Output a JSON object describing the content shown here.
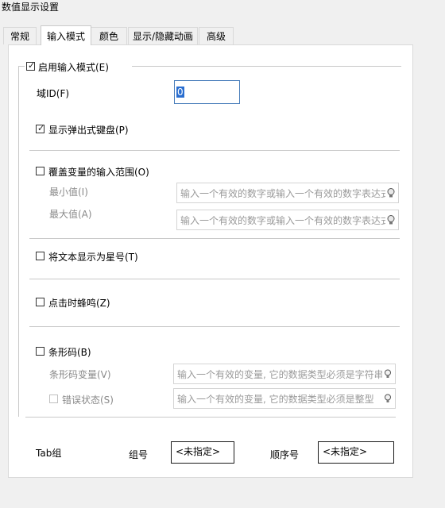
{
  "window": {
    "title": "数值显示设置"
  },
  "tabs": [
    {
      "label": "常规",
      "active": false
    },
    {
      "label": "输入模式",
      "active": true
    },
    {
      "label": "颜色",
      "active": false
    },
    {
      "label": "显示/隐藏动画",
      "active": false
    },
    {
      "label": "高级",
      "active": false
    }
  ],
  "input_mode": {
    "enable": {
      "label": "启用输入模式(E)",
      "checked": true
    },
    "field_id": {
      "label": "域ID(F)",
      "value": "0"
    },
    "show_keyboard": {
      "label": "显示弹出式键盘(P)",
      "checked": true
    },
    "override_range": {
      "label": "覆盖变量的输入范围(O)",
      "checked": false,
      "min_label": "最小值(I)",
      "max_label": "最大值(A)",
      "min_placeholder": "输入一个有效的数字或输入一个有效的数字表达式",
      "max_placeholder": "输入一个有效的数字或输入一个有效的数字表达式"
    },
    "asterisk": {
      "label": "将文本显示为星号(T)",
      "checked": false
    },
    "beep": {
      "label": "点击时蜂鸣(Z)",
      "checked": false
    },
    "barcode": {
      "label": "条形码(B)",
      "checked": false,
      "var_label": "条形码变量(V)",
      "var_placeholder": "输入一个有效的变量, 它的数据类型必须是字符串",
      "error_label": "错误状态(S)",
      "error_checked": false,
      "error_placeholder": "输入一个有效的变量, 它的数据类型必须是整型"
    },
    "tab_group": {
      "label": "Tab组",
      "group_label": "组号",
      "group_value": "<未指定>",
      "order_label": "顺序号",
      "order_value": "<未指定>"
    }
  },
  "icons": {
    "bulb": "lightbulb-icon",
    "check": "checkmark-icon"
  }
}
